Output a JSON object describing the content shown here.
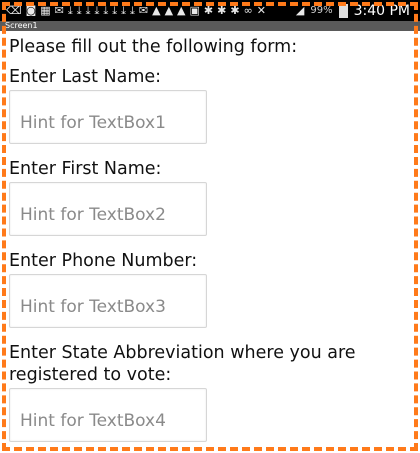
{
  "status_bar": {
    "battery_percent": "99%",
    "time": "3:40 PM",
    "icons": [
      "back-icon",
      "signal-icon",
      "calendar-icon",
      "mail-icon",
      "download-icon",
      "download-icon",
      "download-icon",
      "download-icon",
      "download-icon",
      "download-icon",
      "download-icon",
      "download-icon",
      "mail-icon",
      "warning-icon",
      "warning-icon",
      "warning-icon",
      "image-icon",
      "settings-icon",
      "settings-icon",
      "settings-icon",
      "voicemail-icon",
      "mute-icon",
      "wifi-icon",
      "battery-icon"
    ]
  },
  "title_bar": {
    "title": "Screen1"
  },
  "form": {
    "heading": "Please fill out the following form:",
    "fields": [
      {
        "label": "Enter Last Name:",
        "placeholder": "Hint for TextBox1",
        "value": ""
      },
      {
        "label": "Enter First Name:",
        "placeholder": "Hint for TextBox2",
        "value": ""
      },
      {
        "label": "Enter Phone Number:",
        "placeholder": "Hint for TextBox3",
        "value": ""
      },
      {
        "label": "Enter State Abbreviation where you are registered to vote:",
        "placeholder": "Hint for TextBox4",
        "value": ""
      }
    ]
  },
  "colors": {
    "dashed_border": "#ff7a1a",
    "status_bar_bg": "#000000",
    "title_bar_bg": "#5a5a5a"
  }
}
